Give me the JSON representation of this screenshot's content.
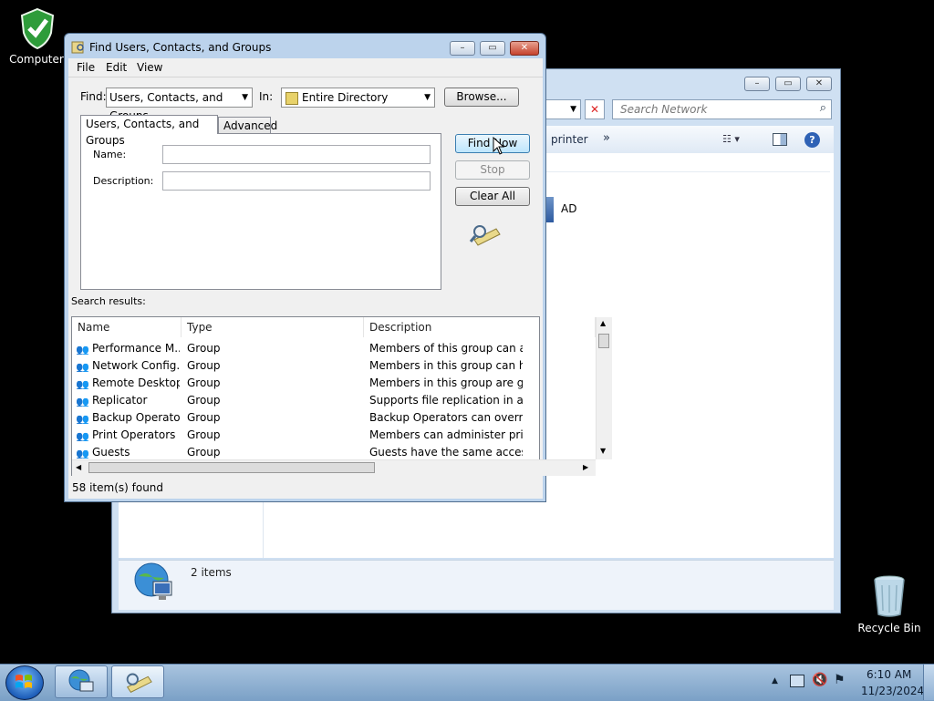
{
  "desktop": {
    "computer_label": "Computer",
    "recycle_label": "Recycle Bin"
  },
  "explorer": {
    "search_placeholder": "Search Network",
    "toolbar_printer": "printer",
    "toolbar_more": "»",
    "item_ad": "AD",
    "status_count": "2 items"
  },
  "dialog": {
    "title": "Find Users, Contacts, and Groups",
    "menu": [
      "File",
      "Edit",
      "View"
    ],
    "find_label": "Find:",
    "find_value": "Users, Contacts, and Groups",
    "in_label": "In:",
    "in_value": "Entire Directory",
    "browse_label": "Browse...",
    "tabs": [
      "Users, Contacts, and Groups",
      "Advanced"
    ],
    "name_label": "Name:",
    "description_label": "Description:",
    "find_now_label": "Find Now",
    "stop_label": "Stop",
    "clear_all_label": "Clear All",
    "search_results_label": "Search results:",
    "columns": [
      "Name",
      "Type",
      "Description"
    ],
    "rows": [
      {
        "name": "Performance M...",
        "type": "Group",
        "description": "Members of this group can acce"
      },
      {
        "name": "Network Config...",
        "type": "Group",
        "description": "Members in this group can have"
      },
      {
        "name": "Remote Desktop...",
        "type": "Group",
        "description": "Members in this group are grant"
      },
      {
        "name": "Replicator",
        "type": "Group",
        "description": "Supports file replication in a dor"
      },
      {
        "name": "Backup Operators",
        "type": "Group",
        "description": "Backup Operators can override s"
      },
      {
        "name": "Print Operators",
        "type": "Group",
        "description": "Members can administer printer"
      },
      {
        "name": "Guests",
        "type": "Group",
        "description": "Guests have the same access as"
      }
    ],
    "status": "58 item(s) found"
  },
  "taskbar": {
    "time": "6:10 AM",
    "date": "11/23/2024"
  }
}
